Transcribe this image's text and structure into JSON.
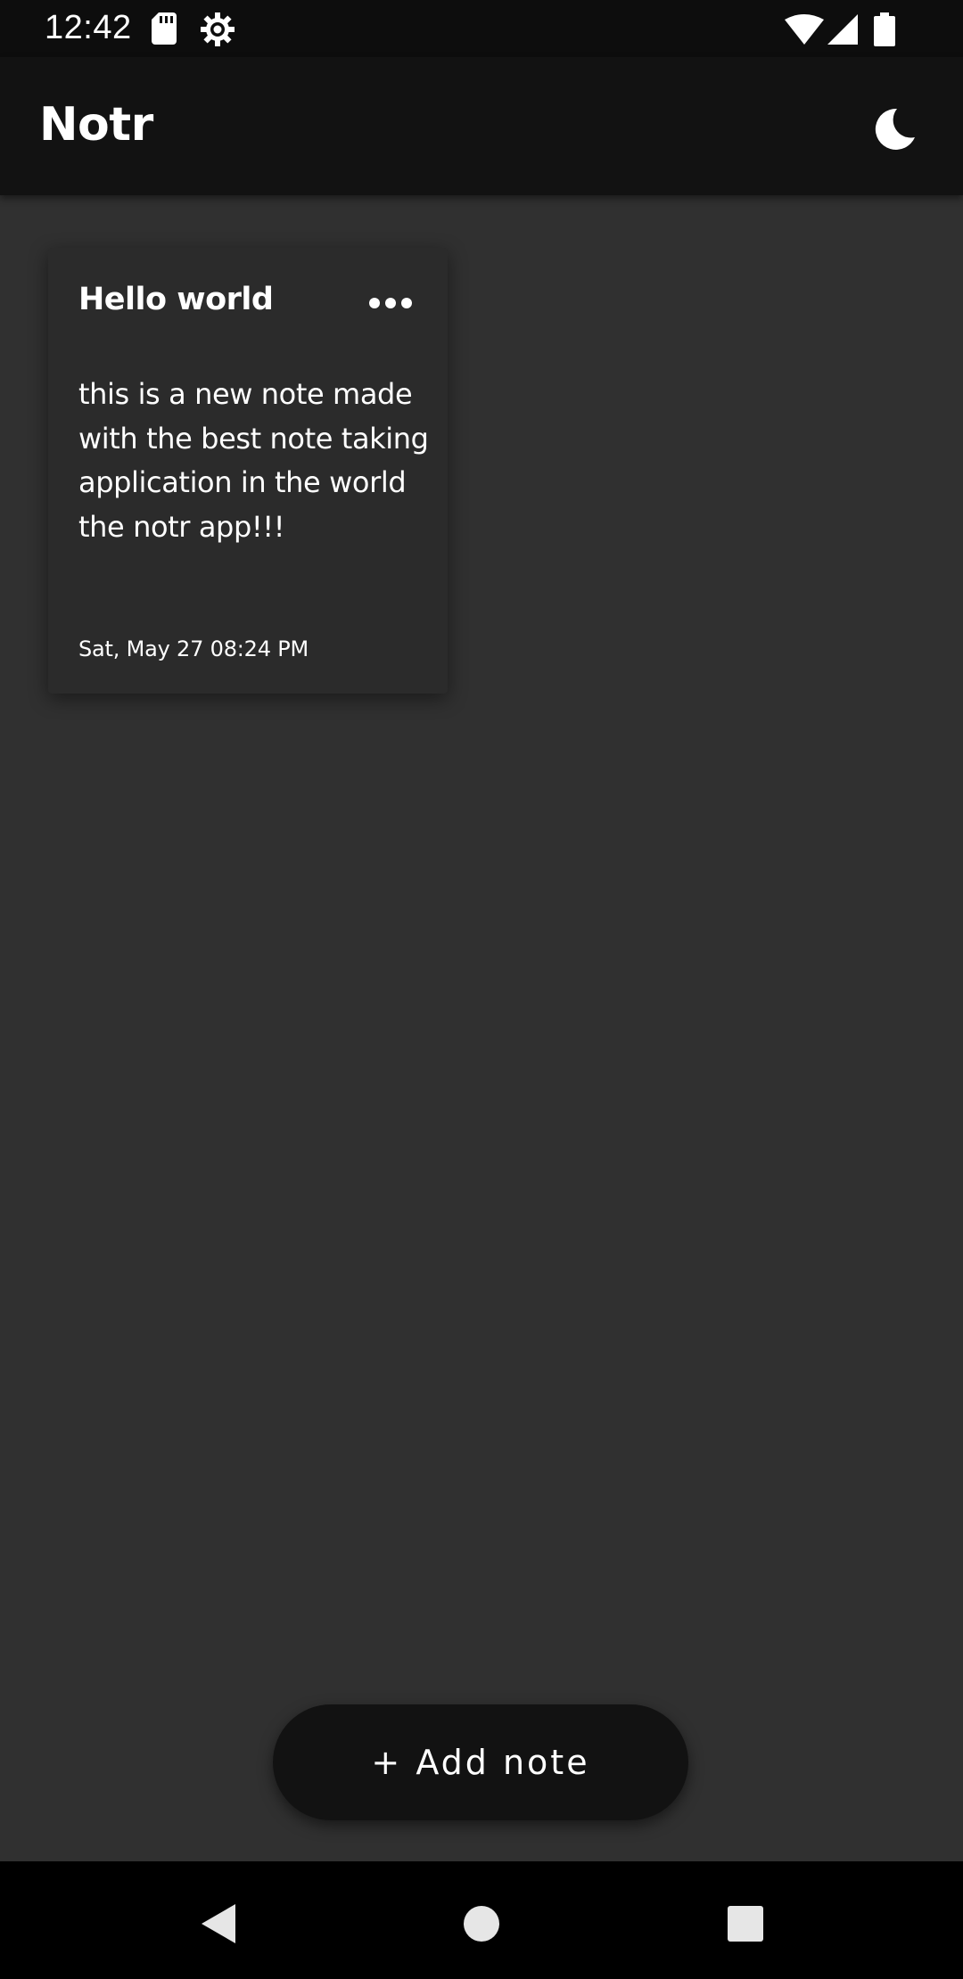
{
  "status_bar": {
    "time": "12:42",
    "icons_left": [
      "sd-card-icon",
      "settings-gear-icon"
    ],
    "icons_right": [
      "wifi-icon",
      "cellular-signal-icon",
      "battery-icon"
    ]
  },
  "app_bar": {
    "title": "Notr",
    "theme_toggle_icon": "moon-icon"
  },
  "notes": [
    {
      "title": "Hello world",
      "body": "this is a new note made with the best note taking application in the world the notr app!!!",
      "date": "Sat, May 27 08:24 PM",
      "menu_icon": "more-horizontal-icon"
    }
  ],
  "add_note_button": {
    "label": "+ Add note"
  },
  "nav_bar": {
    "buttons": [
      "back-icon",
      "home-icon",
      "recents-icon"
    ]
  },
  "colors": {
    "background": "#303030",
    "app_bar": "#121212",
    "card": "#2b2b2b",
    "text": "#ffffff"
  }
}
